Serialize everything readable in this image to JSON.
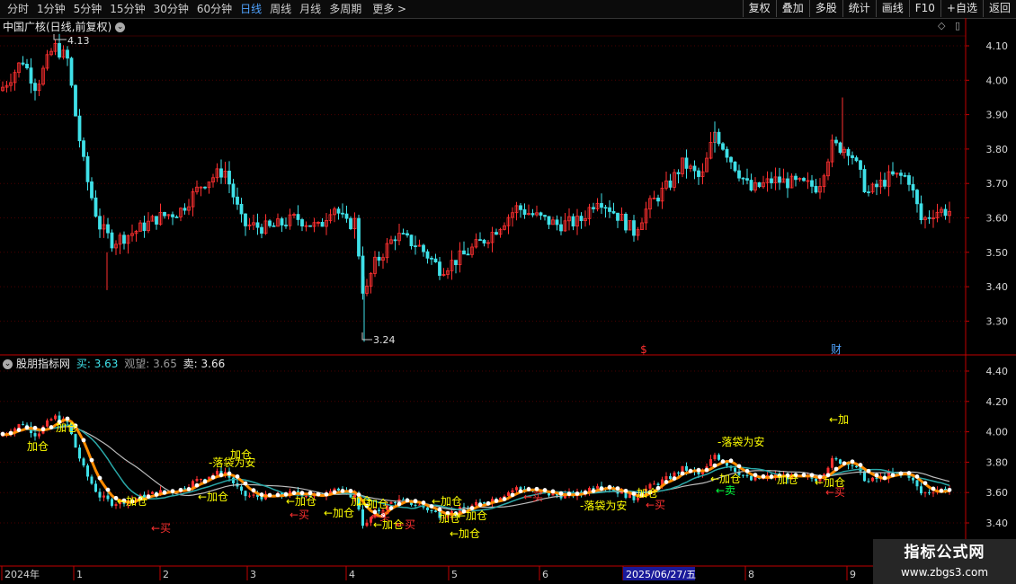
{
  "toolbar": {
    "tabs": [
      "分时",
      "1分钟",
      "5分钟",
      "15分钟",
      "30分钟",
      "60分钟",
      "日线",
      "周线",
      "月线",
      "多周期",
      "更多 >"
    ],
    "active_tab": "日线",
    "right_buttons": [
      "复权",
      "叠加",
      "多股",
      "统计",
      "画线",
      "F10",
      "+自选",
      "返回"
    ]
  },
  "main_chart": {
    "title": "中国广核(日线,前复权)",
    "high_label": "4.13",
    "low_label": "3.24",
    "y_ticks": [
      "4.10",
      "4.00",
      "3.90",
      "3.80",
      "3.70",
      "3.60",
      "3.50",
      "3.40",
      "3.30"
    ],
    "markers": [
      {
        "text": "$",
        "color": "#ff3030"
      },
      {
        "text": "财",
        "color": "#4fa3ff"
      }
    ]
  },
  "indicator": {
    "name": "股朋指标网",
    "buy_label": "买: 3.63",
    "watch_label": "观望: 3.65",
    "sell_label": "卖: 3.66",
    "y_ticks": [
      "4.40",
      "4.20",
      "4.00",
      "3.80",
      "3.60",
      "3.40"
    ],
    "annotations": [
      {
        "text": "加仓",
        "color": "#ffff00"
      },
      {
        "text": "加仓",
        "color": "#ffff00"
      },
      {
        "text": "←加仓",
        "color": "#ffff00"
      },
      {
        "text": "←买",
        "color": "#ff3030"
      },
      {
        "text": "-落袋为安",
        "color": "#ffff00"
      },
      {
        "text": "加仓",
        "color": "#ffff00"
      },
      {
        "text": "←加仓",
        "color": "#ffff00"
      },
      {
        "text": "←加仓",
        "color": "#ffff00"
      },
      {
        "text": "←买",
        "color": "#ff3030"
      },
      {
        "text": "←加仓",
        "color": "#ffff00"
      },
      {
        "text": "加仓",
        "color": "#ffff00"
      },
      {
        "text": "←加仓",
        "color": "#ffff00"
      },
      {
        "text": "←买",
        "color": "#ff3030"
      },
      {
        "text": "←加仓",
        "color": "#ffff00"
      },
      {
        "text": "←买",
        "color": "#ff3030"
      },
      {
        "text": "←加仓",
        "color": "#ffff00"
      },
      {
        "text": "加仓",
        "color": "#ffff00"
      },
      {
        "text": "←加仓",
        "color": "#ffff00"
      },
      {
        "text": "←加仓",
        "color": "#ffff00"
      },
      {
        "text": "←买",
        "color": "#ff3030"
      },
      {
        "text": "-落袋为安",
        "color": "#ffff00"
      },
      {
        "text": "加仓",
        "color": "#ffff00"
      },
      {
        "text": "←买",
        "color": "#ff3030"
      },
      {
        "text": "←加仓",
        "color": "#ffff00"
      },
      {
        "text": "←卖",
        "color": "#00ff40"
      },
      {
        "text": "-落袋为安",
        "color": "#ffff00"
      },
      {
        "text": "加仓",
        "color": "#ffff00"
      },
      {
        "text": "←买",
        "color": "#ff3030"
      },
      {
        "text": "←加仓",
        "color": "#ffff00"
      },
      {
        "text": "←加",
        "color": "#ffff00"
      }
    ]
  },
  "date_axis": {
    "labels": [
      "2024年",
      "1",
      "2",
      "3",
      "4",
      "5",
      "6",
      "2025/06/27/五",
      "8",
      "9"
    ]
  },
  "watermark": {
    "line1": "指标公式网",
    "line2": "www.zbgs3.com"
  },
  "colors": {
    "up": "#ff3030",
    "down": "#3fe0e8",
    "grid": "#4a0000",
    "axis": "#c00000"
  }
}
